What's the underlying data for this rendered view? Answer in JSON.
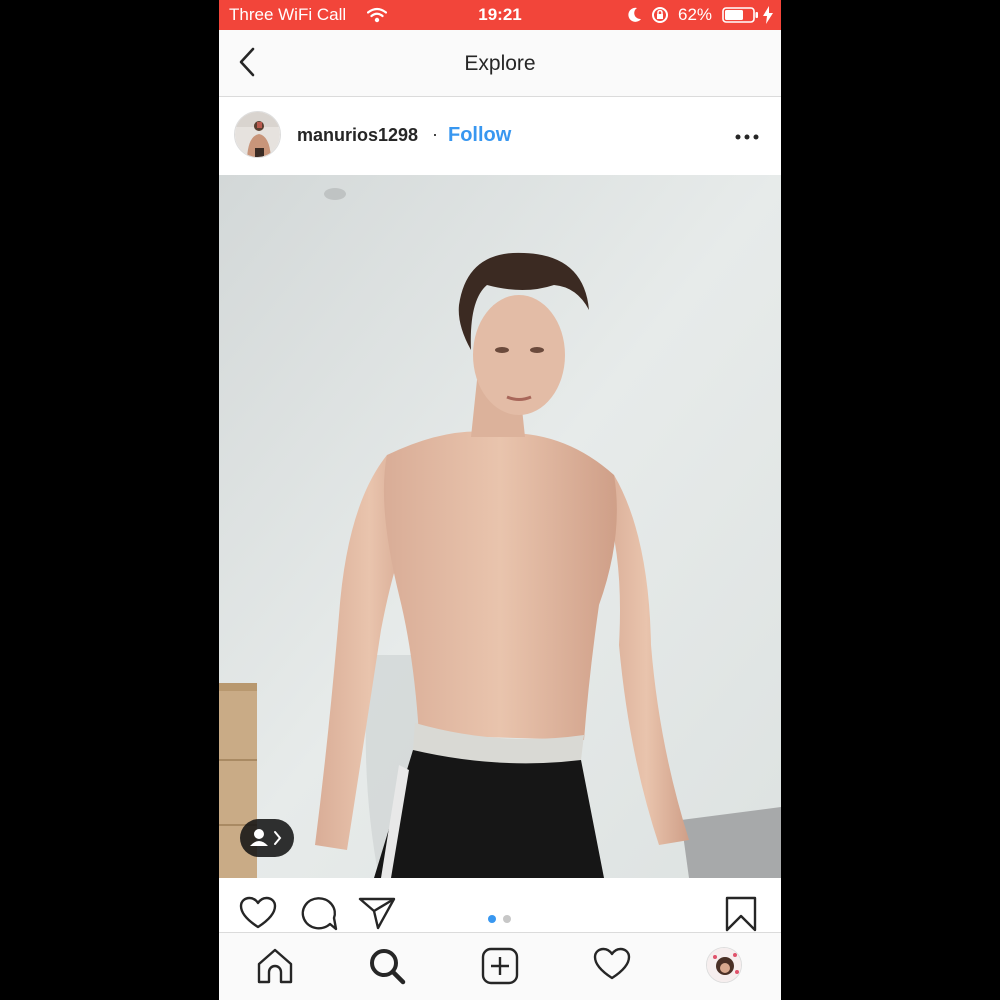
{
  "status_bar": {
    "carrier": "Three WiFi Call",
    "time": "19:21",
    "battery": "62%",
    "icons": [
      "wifi-icon",
      "moon-icon",
      "rotation-lock-icon",
      "battery-icon",
      "charging-bolt-icon"
    ],
    "background_color": "#f2453a"
  },
  "nav": {
    "title": "Explore",
    "back_icon": "chevron-left-icon"
  },
  "post": {
    "username": "manurios1298",
    "separator": "·",
    "follow_label": "Follow",
    "follow_color": "#3897f0",
    "more_icon": "more-horizontal-icon",
    "media": {
      "type": "video",
      "tag_icon": "user-tag-icon"
    },
    "carousel": {
      "count": 2,
      "active_index": 0
    },
    "actions": [
      "like-icon",
      "comment-icon",
      "share-icon",
      "bookmark-icon"
    ]
  },
  "tab_bar": {
    "tabs": [
      "home-icon",
      "search-icon",
      "new-post-icon",
      "activity-icon",
      "profile-avatar"
    ],
    "active_tab": "search-icon"
  }
}
